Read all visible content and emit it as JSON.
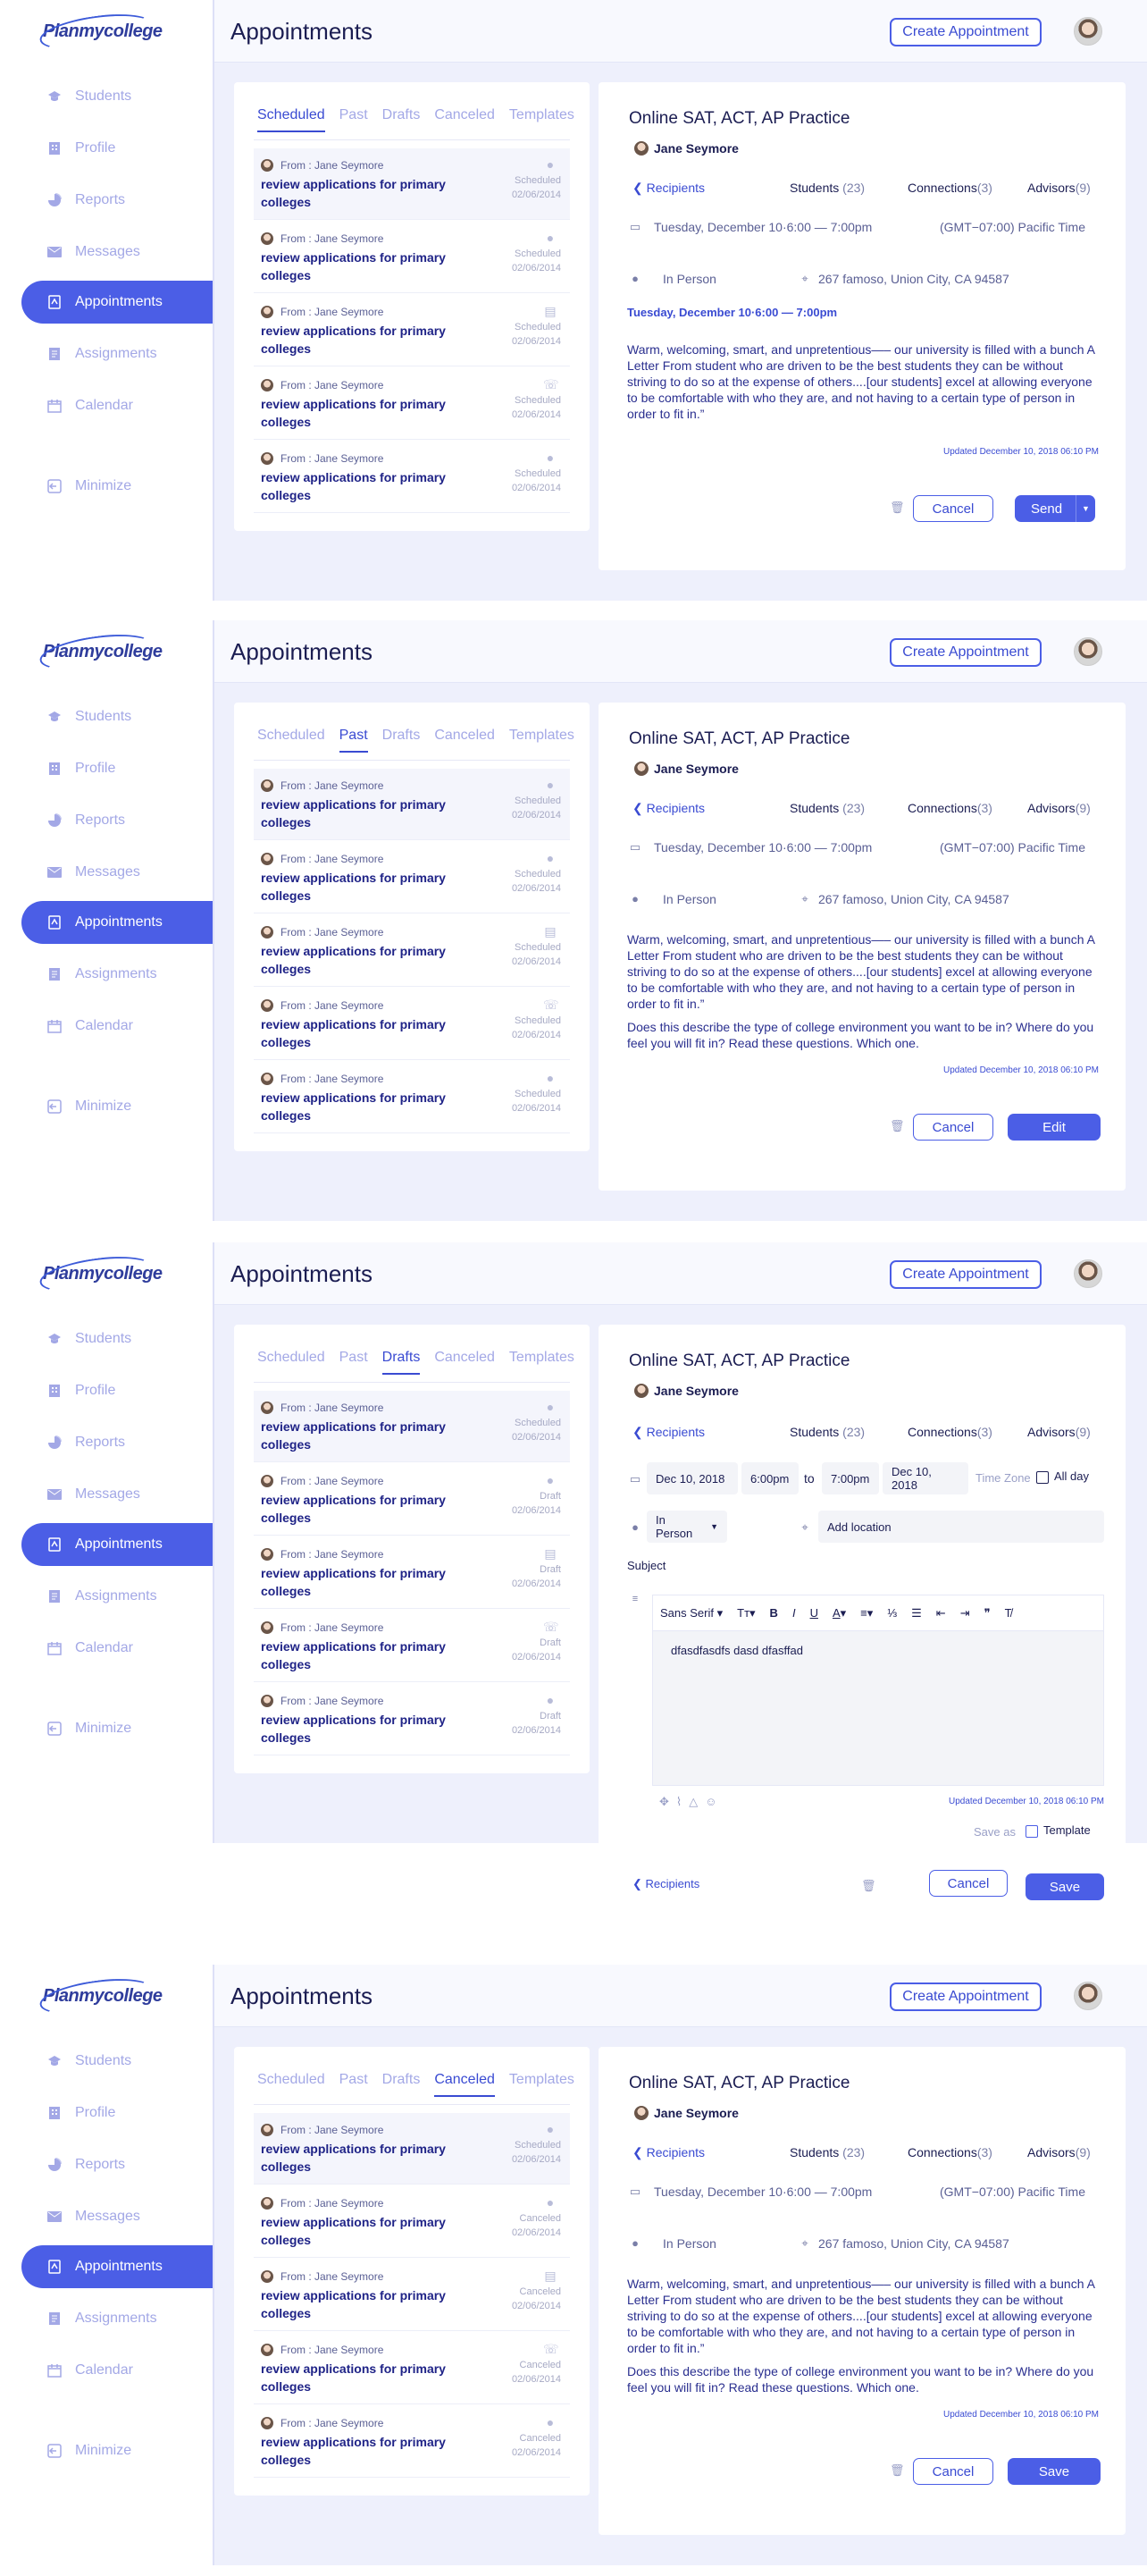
{
  "sidebar": {
    "logo": "Planmycollege",
    "items": [
      {
        "label": "Students",
        "icon": "graduation-cap-icon"
      },
      {
        "label": "Profile",
        "icon": "building-icon"
      },
      {
        "label": "Reports",
        "icon": "pie-chart-icon"
      },
      {
        "label": "Messages",
        "icon": "envelope-icon"
      },
      {
        "label": "Appointments",
        "icon": "appointment-icon"
      },
      {
        "label": "Assignments",
        "icon": "document-icon"
      },
      {
        "label": "Calendar",
        "icon": "calendar-icon"
      }
    ],
    "minimize": "Minimize"
  },
  "header": {
    "title": "Appointments",
    "create_button": "Create Appointment"
  },
  "tabs": [
    "Scheduled",
    "Past",
    "Drafts",
    "Canceled",
    "Templates"
  ],
  "message": {
    "from": "From :  Jane Seymore",
    "subject": "review applications for primary colleges",
    "date": "02/06/2014"
  },
  "frames": [
    {
      "active_tab": 0,
      "statuses": [
        "Scheduled",
        "Scheduled",
        "Scheduled",
        "Scheduled",
        "Scheduled"
      ]
    },
    {
      "active_tab": 1,
      "statuses": [
        "Scheduled",
        "Scheduled",
        "Scheduled",
        "Scheduled",
        "Scheduled"
      ]
    },
    {
      "active_tab": 2,
      "statuses": [
        "Scheduled",
        "Draft",
        "Draft",
        "Draft",
        "Draft"
      ]
    },
    {
      "active_tab": 3,
      "statuses": [
        "Scheduled",
        "Canceled",
        "Canceled",
        "Canceled",
        "Canceled"
      ]
    }
  ],
  "detail": {
    "title": "Online SAT, ACT, AP Practice",
    "host": "Jane Seymore",
    "recipients": "Recipients",
    "students": "Students",
    "students_count": "(23)",
    "connections": "Connections",
    "connections_count": "(3)",
    "advisors": "Advisors",
    "advisors_count": "(9)",
    "datetime": "Tuesday, December 10·6:00 — 7:00pm",
    "timezone": "(GMT−07:00) Pacific Time",
    "mode": "In Person",
    "address": "267 famoso, Union City, CA 94587",
    "highlight_time": "Tuesday, December 10·6:00 — 7:00pm",
    "body": "Warm, welcoming, smart, and unpretentious—– our university is filled with a bunch A Letter From  student who are driven to be the best students they can be without striving to do so at the expense of others....[our students] excel at allowing everyone to be comfortable with who they are, and not having to a certain type of person in order to fit in.”",
    "body2": "Does this describe the type of college environment you want to be in? Where do you feel you will fit in?  Read these questions. Which one.",
    "updated": "Updated December 10, 2018 06:10 PM",
    "cancel": "Cancel",
    "send": "Send",
    "edit": "Edit",
    "save": "Save"
  },
  "draft_form": {
    "start_date": "Dec 10, 2018",
    "start_time": "6:00pm",
    "to": "to",
    "end_time": "7:00pm",
    "end_date": "Dec 10, 2018",
    "timezone_label": "Time Zone",
    "all_day": "All day",
    "mode": "In Person",
    "location_placeholder": "Add location",
    "subject_label": "Subject",
    "font": "Sans Serif",
    "editor_text": "dfasdfasdfs  dasd  dfasffad",
    "save_as": "Save as",
    "template": "Template"
  },
  "colors": {
    "accent": "#4b5ee6",
    "navy": "#1b1d52",
    "muted": "#a3a8e6"
  }
}
